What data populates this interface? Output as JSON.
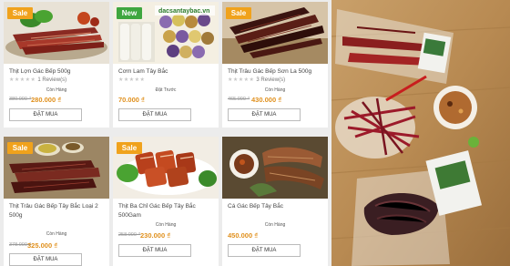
{
  "products": [
    {
      "title": "Thịt Lợn Gác Bếp 500g",
      "badge": "Sale",
      "stars": "★★★★★",
      "reviews": "1 Review(s)",
      "stock": "Còn Hàng",
      "old_price": "380.000 ₫",
      "price": "280.000 ₫",
      "buy": "ĐẶT MUA"
    },
    {
      "title": "Cơm Lam Tây Bắc",
      "badge": "New",
      "watermark": "dacsantaybac.vn",
      "stars": "★★★★★",
      "stock": "Đặt Trước",
      "price": "70.000 ₫",
      "buy": "ĐẶT MUA"
    },
    {
      "title": "Thịt Trâu Gác Bếp Sơn La 500g",
      "badge": "Sale",
      "stars": "★★★★★",
      "reviews": "3 Review(s)",
      "stock": "Còn Hàng",
      "old_price": "465.000 ₫",
      "price": "430.000 ₫",
      "buy": "ĐẶT MUA"
    },
    {
      "title": "Thịt Trâu Gác Bếp Tây Bắc Loại 2 500g",
      "badge": "Sale",
      "stock": "Còn Hàng",
      "old_price": "378.000 ₫",
      "price": "325.000 ₫",
      "buy": "ĐẶT MUA"
    },
    {
      "title": "Thịt Ba Chỉ Gác Bếp Tây Bắc 500Gam",
      "badge": "Sale",
      "stock": "Còn Hàng",
      "old_price": "258.000 ₫",
      "price": "230.000 ₫",
      "buy": "ĐẶT MUA"
    },
    {
      "title": "Cá Gác Bếp Tây Bắc",
      "stock": "Còn Hàng",
      "price": "450.000 ₫",
      "buy": "ĐẶT MUA"
    }
  ],
  "colors": {
    "sale": "#f0a21c",
    "new": "#3fa63f",
    "price": "#e0901d"
  }
}
